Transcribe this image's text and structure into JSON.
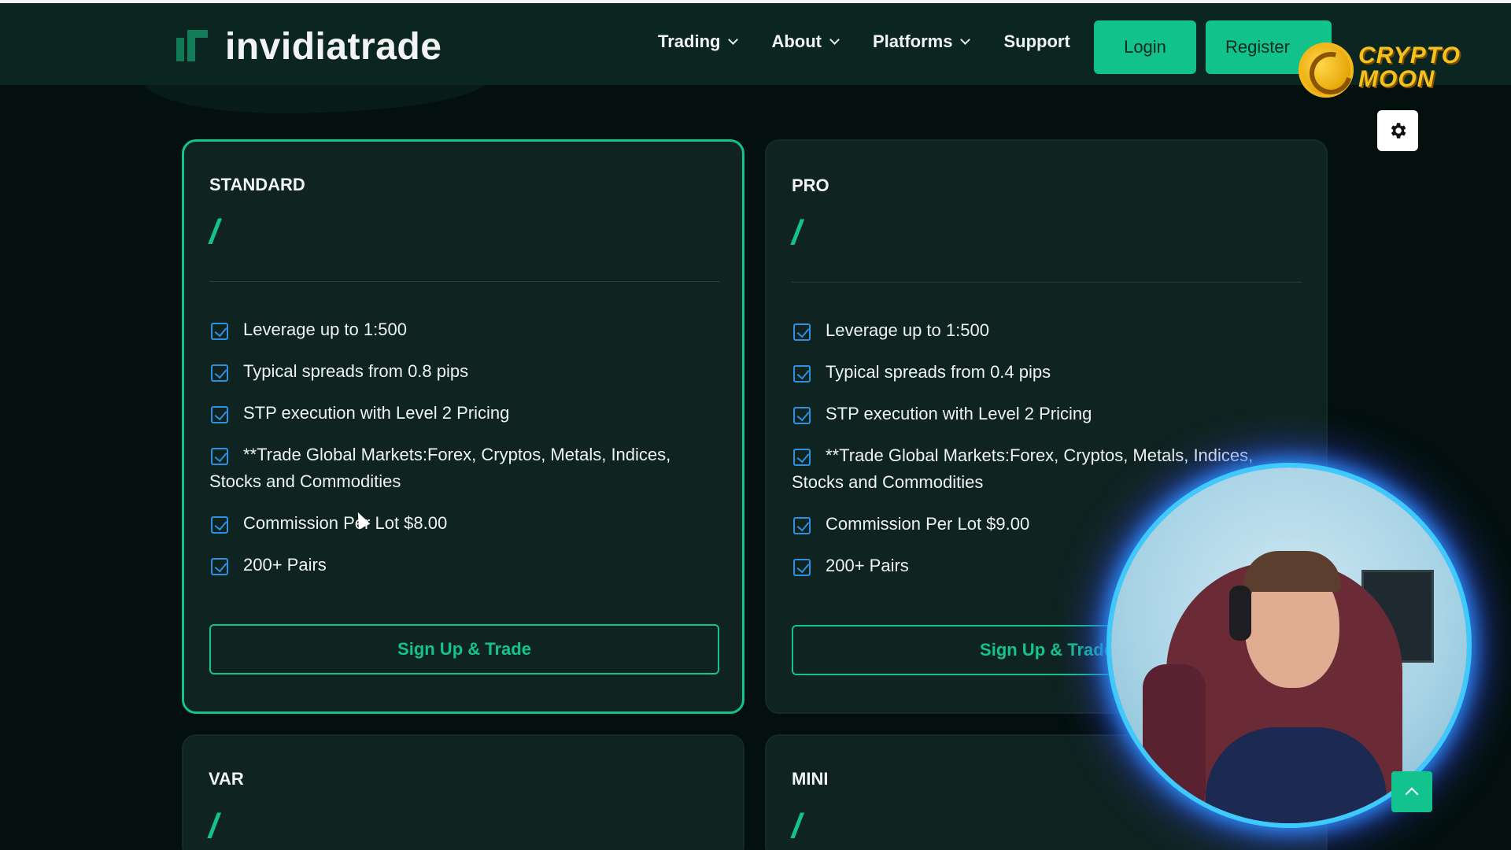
{
  "header": {
    "logo_text": "invidiatrade",
    "nav": [
      {
        "label": "Trading"
      },
      {
        "label": "About"
      },
      {
        "label": "Platforms"
      },
      {
        "label": "Support"
      }
    ],
    "login_label": "Login",
    "register_label": "Register"
  },
  "overlay": {
    "channel_logo_line1": "CRYPTO",
    "channel_logo_line2": "MOON"
  },
  "plans": [
    {
      "name": "STANDARD",
      "price": "/",
      "features": [
        "Leverage up to 1:500",
        "Typical spreads from 0.8 pips",
        "STP execution with Level 2 Pricing",
        "**Trade Global Markets:Forex, Cryptos, Metals, Indices, Stocks and Commodities",
        "Commission Per Lot $8.00",
        "200+ Pairs"
      ],
      "cta": "Sign Up & Trade"
    },
    {
      "name": "PRO",
      "price": "/",
      "features": [
        "Leverage up to 1:500",
        "Typical spreads from 0.4 pips",
        "STP execution with Level 2 Pricing",
        "**Trade Global Markets:Forex, Cryptos, Metals, Indices, Stocks and Commodities",
        "Commission Per Lot $9.00",
        "200+ Pairs"
      ],
      "cta": "Sign Up & Trade"
    },
    {
      "name": "VAR",
      "price": "/"
    },
    {
      "name": "MINI",
      "price": "/"
    }
  ],
  "colors": {
    "accent": "#13c38d",
    "navbar": "#0b2621",
    "card": "#0f2320",
    "background": "#04100e",
    "checkbox": "#2f8fe0"
  },
  "icons": {
    "settings": "gear-icon",
    "scroll_top": "chevron-up-icon",
    "feature_check": "checkbox-checked-icon"
  }
}
